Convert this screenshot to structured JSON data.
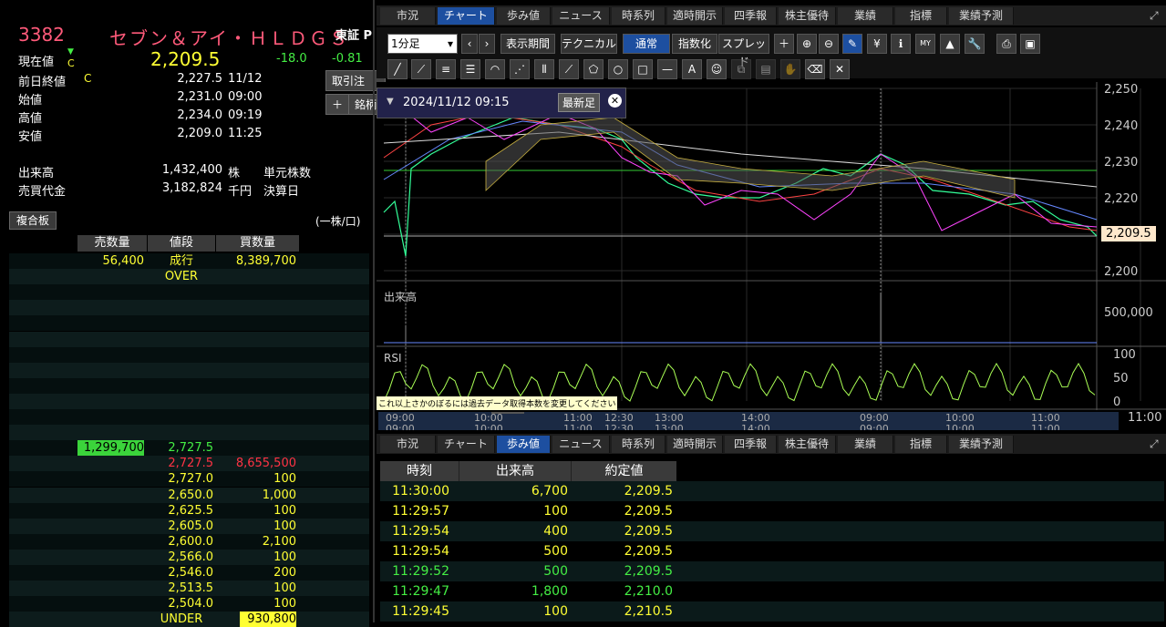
{
  "quote": {
    "code": "3382",
    "name": "セブン＆アイ・ＨＬＤＧＳ",
    "market": "東証 P",
    "current_label": "現在値",
    "arrow": "▼",
    "c_flag": "C",
    "price": "2,209.5",
    "change": "-18.0",
    "change_pct": "-0.81",
    "rows": [
      {
        "label": "前日終値",
        "flag": "C",
        "value": "2,227.5",
        "time": "11/12"
      },
      {
        "label": "始値",
        "flag": "",
        "value": "2,231.0",
        "time": "09:00"
      },
      {
        "label": "高値",
        "flag": "",
        "value": "2,234.0",
        "time": "09:19"
      },
      {
        "label": "安値",
        "flag": "",
        "value": "2,209.0",
        "time": "11:25"
      }
    ],
    "volume_label": "出来高",
    "volume": "1,432,400",
    "volume_unit": "株",
    "turnover_label": "売買代金",
    "turnover": "3,182,824",
    "turnover_unit": "千円",
    "unit_shares_label": "単元株数",
    "settle_label": "決算日",
    "torihiki_btn": "取引注",
    "meigara_btn": "銘柄",
    "plus": "＋"
  },
  "book": {
    "tab": "複合板",
    "unit": "(一株/口)",
    "headers": {
      "sell": "売数量",
      "price": "値段",
      "buy": "買数量"
    },
    "top": {
      "sell": "56,400",
      "price": "成行",
      "buy": "8,389,700"
    },
    "over": "OVER",
    "sell_highlight": "1,299,700",
    "sell_highlight_price": "2,727.5",
    "bids": [
      {
        "price": "2,727.5",
        "buy": "8,655,500"
      },
      {
        "price": "2,727.0",
        "buy": "100"
      },
      {
        "price": "2,650.0",
        "buy": "1,000"
      },
      {
        "price": "2,625.5",
        "buy": "100"
      },
      {
        "price": "2,605.0",
        "buy": "100"
      },
      {
        "price": "2,600.0",
        "buy": "2,100"
      },
      {
        "price": "2,566.0",
        "buy": "100"
      },
      {
        "price": "2,546.0",
        "buy": "200"
      },
      {
        "price": "2,513.5",
        "buy": "100"
      },
      {
        "price": "2,504.0",
        "buy": "100"
      }
    ],
    "under": "UNDER",
    "under_buy": "930,800"
  },
  "tabs": [
    "市況",
    "チャート",
    "歩み値",
    "ニュース",
    "時系列",
    "適時開示",
    "四季報",
    "株主優待",
    "業績",
    "指標",
    "業績予測"
  ],
  "chart_toolbar": {
    "interval": "1分足",
    "period": "表示期間",
    "technical": "テクニカル",
    "normal": "通常",
    "index": "指数化",
    "spread": "スプレッド",
    "date": "2024/11/12 09:15",
    "latest": "最新足",
    "notice": "これ以上さかのぼるには過去データ取得本数を変更してください"
  },
  "chart_data": {
    "type": "line",
    "price_axis": [
      "2,250",
      "2,240",
      "2,230",
      "2,220",
      "2,210",
      "2,200"
    ],
    "ylim": [
      2200,
      2250
    ],
    "last_price": "2,209.5",
    "volume_label": "出来高",
    "volume_axis": "500,000",
    "rsi_label": "RSI",
    "rsi_axis": [
      "100",
      "50",
      "0"
    ],
    "time_ticks": [
      "13:00",
      "14:00",
      "09:00",
      "10:00",
      "11:00"
    ],
    "nav_top_ticks": [
      "09:00",
      "10:00",
      "11:00",
      "12:30",
      "13:00",
      "14:00",
      "09:00",
      "10:00",
      "11:00"
    ],
    "nav_bot_ticks": [
      "09:00",
      "10:00",
      "11:00",
      "12:30",
      "13:00",
      "14:00",
      "09:00",
      "10:00",
      "11:00"
    ]
  },
  "trades": {
    "headers": [
      "時刻",
      "出来高",
      "約定値"
    ],
    "rows": [
      {
        "time": "11:30:00",
        "vol": "6,700",
        "price": "2,209.5",
        "color": "yellow"
      },
      {
        "time": "11:29:57",
        "vol": "100",
        "price": "2,209.5",
        "color": "yellow"
      },
      {
        "time": "11:29:54",
        "vol": "400",
        "price": "2,209.5",
        "color": "yellow"
      },
      {
        "time": "11:29:54",
        "vol": "500",
        "price": "2,209.5",
        "color": "yellow"
      },
      {
        "time": "11:29:52",
        "vol": "500",
        "price": "2,209.5",
        "color": "green"
      },
      {
        "time": "11:29:47",
        "vol": "1,800",
        "price": "2,210.0",
        "color": "green"
      },
      {
        "time": "11:29:45",
        "vol": "100",
        "price": "2,210.5",
        "color": "yellow"
      }
    ]
  }
}
